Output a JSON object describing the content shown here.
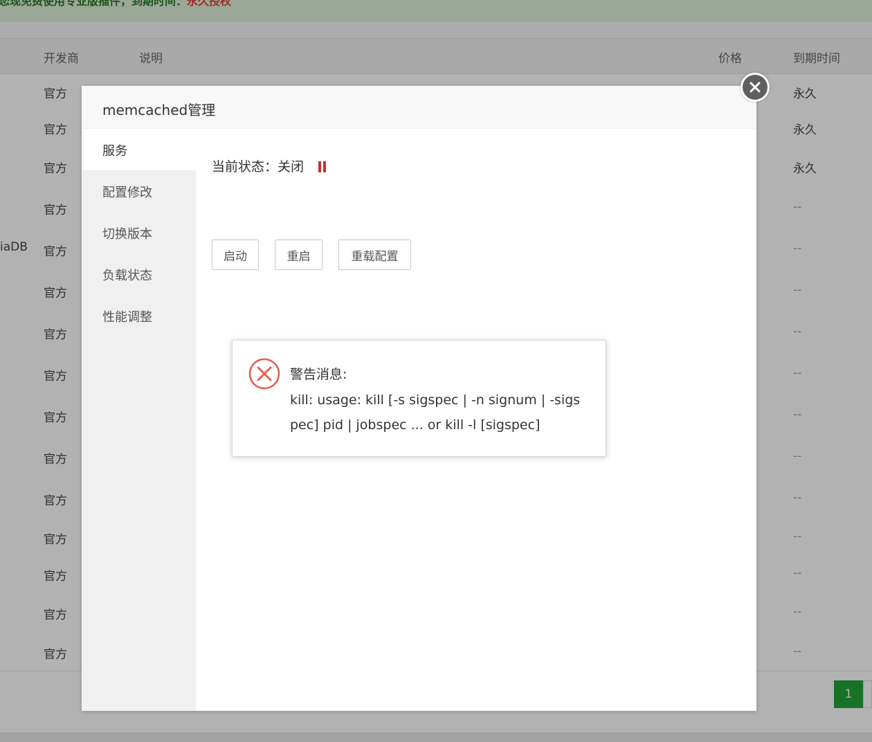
{
  "banner": {
    "text": "您现免费使用专业版插件，到期时间：",
    "highlight": "永久授权"
  },
  "table": {
    "headers": {
      "vendor": "开发商",
      "description": "说明",
      "price": "价格",
      "expire": "到期时间"
    },
    "rows": [
      {
        "vendor": "官方",
        "expire": "永久",
        "name_fragment": ""
      },
      {
        "vendor": "官方",
        "expire": "永久",
        "name_fragment": ""
      },
      {
        "vendor": "官方",
        "expire": "永久",
        "name_fragment": ""
      },
      {
        "vendor": "官方",
        "expire": "--",
        "name_fragment": ""
      },
      {
        "vendor": "官方",
        "expire": "--",
        "name_fragment": "iaDB"
      },
      {
        "vendor": "官方",
        "expire": "--",
        "name_fragment": ""
      },
      {
        "vendor": "官方",
        "expire": "--",
        "name_fragment": ""
      },
      {
        "vendor": "官方",
        "expire": "--",
        "name_fragment": ""
      },
      {
        "vendor": "官方",
        "expire": "--",
        "name_fragment": ""
      },
      {
        "vendor": "官方",
        "expire": "--",
        "name_fragment": ""
      },
      {
        "vendor": "官方",
        "expire": "--",
        "name_fragment": ""
      },
      {
        "vendor": "官方",
        "expire": "--",
        "name_fragment": ""
      },
      {
        "vendor": "官方",
        "expire": "--",
        "name_fragment": ""
      },
      {
        "vendor": "官方",
        "expire": "--",
        "name_fragment": ""
      },
      {
        "vendor": "官方",
        "expire": "--",
        "name_fragment": ""
      }
    ]
  },
  "pagination": {
    "current": "1"
  },
  "modal": {
    "title": "memcached管理",
    "sidebar": [
      {
        "label": "服务",
        "active": true
      },
      {
        "label": "配置修改",
        "active": false
      },
      {
        "label": "切换版本",
        "active": false
      },
      {
        "label": "负载状态",
        "active": false
      },
      {
        "label": "性能调整",
        "active": false
      }
    ],
    "status_text": "当前状态：关闭",
    "status_icon": "pause-icon",
    "status_color": "#c9302c",
    "buttons": {
      "start": "启动",
      "restart": "重启",
      "reload": "重载配置"
    }
  },
  "alert": {
    "title": "警告消息:",
    "message": "kill: usage: kill [-s sigspec | -n signum | -sigspec] pid | jobspec ... or kill -l [sigspec]",
    "icon": "error-circle-icon",
    "icon_color": "#e05c4e"
  }
}
